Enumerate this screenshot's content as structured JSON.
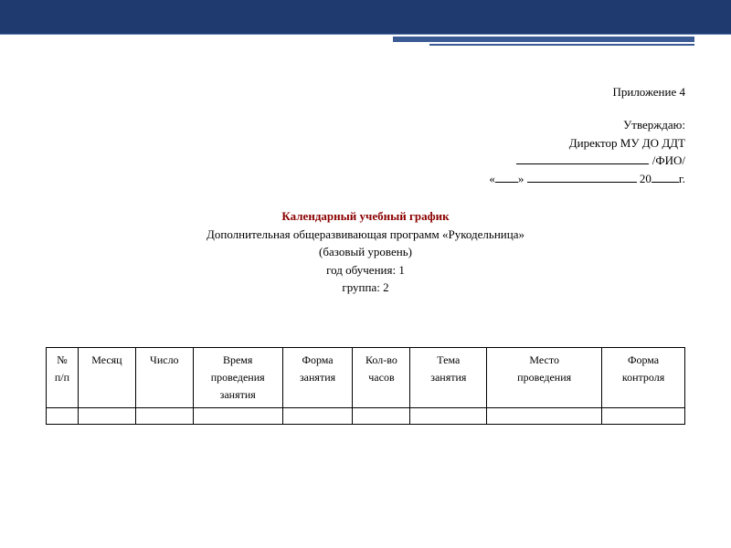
{
  "header": {
    "attachment": "Приложение 4"
  },
  "approval": {
    "approve": "Утверждаю:",
    "director": "Директор МУ ДО ДДТ",
    "fio_suffix": " /ФИО/",
    "date_open": "«",
    "date_mid": "» ",
    "year_prefix": " 20",
    "year_suffix": "г."
  },
  "title": {
    "main": "Календарный учебный график",
    "program": "Дополнительная общеразвивающая программ «Рукодельница»",
    "level": "(базовый уровень)",
    "year": "год обучения: 1",
    "group": "группа: 2"
  },
  "table": {
    "headers": [
      {
        "line1": "№",
        "line2": "п/п"
      },
      {
        "line1": "Месяц",
        "line2": ""
      },
      {
        "line1": "Число",
        "line2": ""
      },
      {
        "line1": "Время",
        "line2": "проведения",
        "line3": "занятия"
      },
      {
        "line1": "Форма",
        "line2": "занятия"
      },
      {
        "line1": "Кол-во",
        "line2": "часов"
      },
      {
        "line1": "Тема",
        "line2": "занятия"
      },
      {
        "line1": "Место",
        "line2": "проведения"
      },
      {
        "line1": "Форма",
        "line2": "контроля"
      }
    ]
  },
  "chart_data": {
    "type": "table",
    "title": "Календарный учебный график",
    "columns": [
      "№ п/п",
      "Месяц",
      "Число",
      "Время проведения занятия",
      "Форма занятия",
      "Кол-во часов",
      "Тема занятия",
      "Место проведения",
      "Форма контроля"
    ],
    "rows": [
      [
        "",
        "",
        "",
        "",
        "",
        "",
        "",
        "",
        ""
      ]
    ]
  }
}
